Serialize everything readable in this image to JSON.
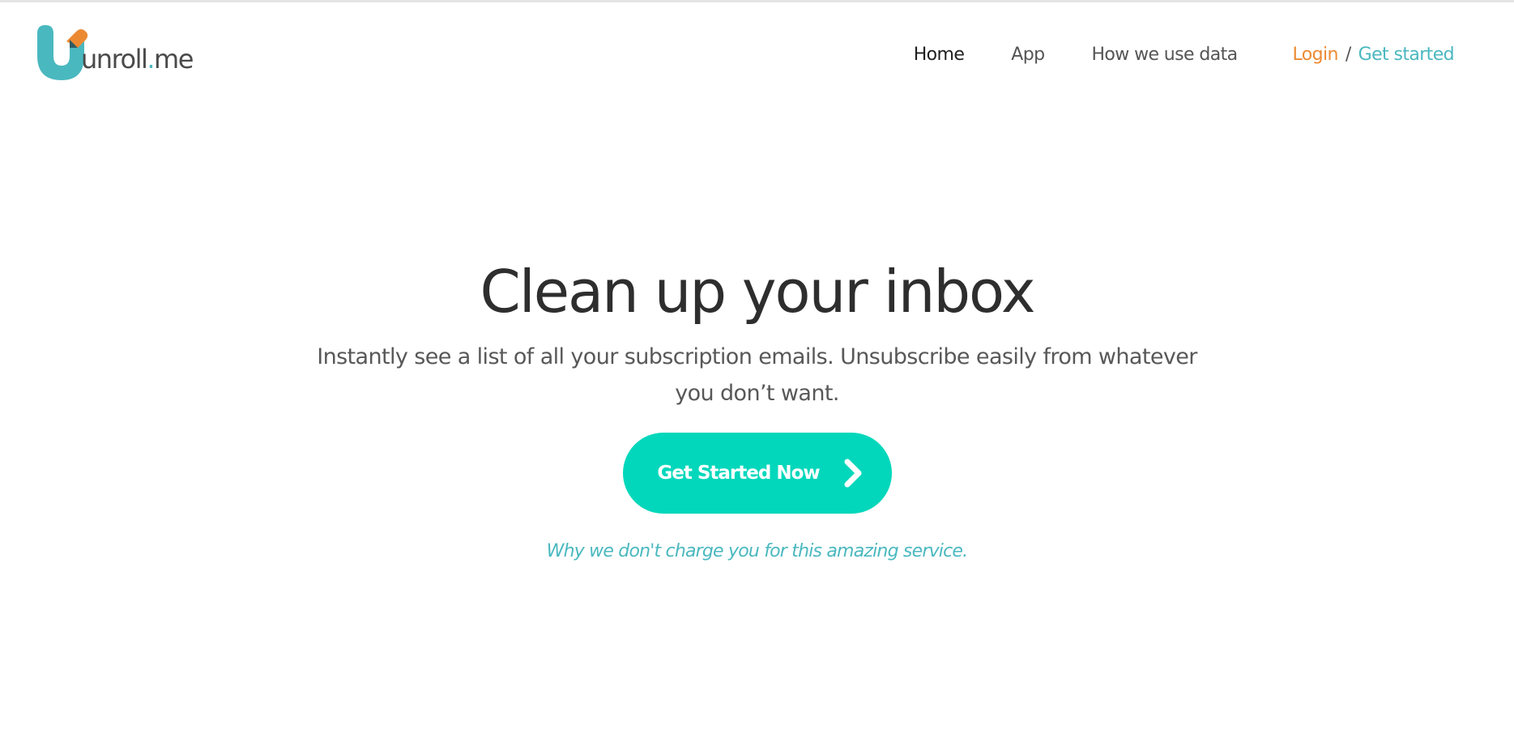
{
  "brand": {
    "name_main": "unroll",
    "name_dot": ".",
    "name_tld": "me",
    "colors": {
      "teal": "#4ab8bf",
      "orange": "#ec8a33",
      "cta_green": "#03d7bb",
      "dark_text": "#2e2e2e"
    }
  },
  "nav": {
    "items": [
      {
        "label": "Home",
        "active": true
      },
      {
        "label": "App",
        "active": false
      },
      {
        "label": "How we use data",
        "active": false
      }
    ],
    "login_label": "Login",
    "separator": "/",
    "get_started_label": "Get started"
  },
  "hero": {
    "title": "Clean up your inbox",
    "subtitle": "Instantly see a list of all your subscription emails. Unsubscribe easily from whatever you don’t want.",
    "cta_label": "Get Started Now",
    "cta_icon": "chevron-right-icon",
    "why_link": "Why we don't charge you for this amazing service."
  }
}
